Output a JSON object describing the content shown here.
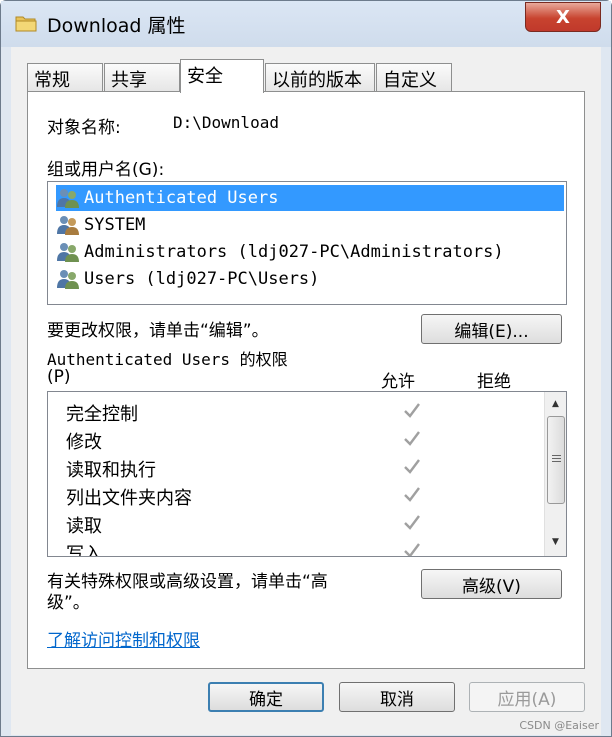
{
  "window": {
    "title": "Download 属性",
    "close_glyph": "X"
  },
  "tabs": [
    {
      "label": "常规",
      "active": false
    },
    {
      "label": "共享",
      "active": false
    },
    {
      "label": "安全",
      "active": true
    },
    {
      "label": "以前的版本",
      "active": false
    },
    {
      "label": "自定义",
      "active": false
    }
  ],
  "security": {
    "object_name_label": "对象名称:",
    "object_name_value": "D:\\Download",
    "group_label": "组或用户名(G):",
    "users": [
      {
        "name": "Authenticated Users",
        "selected": true
      },
      {
        "name": "SYSTEM",
        "selected": false
      },
      {
        "name": "Administrators (ldj027-PC\\Administrators)",
        "selected": false
      },
      {
        "name": "Users (ldj027-PC\\Users)",
        "selected": false
      }
    ],
    "change_hint": "要更改权限，请单击“编辑”。",
    "edit_button": "编辑(E)...",
    "permissions_for_line1": "Authenticated Users 的权限",
    "permissions_for_line2": "(P)",
    "allow_header": "允许",
    "deny_header": "拒绝",
    "permissions": [
      {
        "name": "完全控制",
        "allow": true,
        "deny": false
      },
      {
        "name": "修改",
        "allow": true,
        "deny": false
      },
      {
        "name": "读取和执行",
        "allow": true,
        "deny": false
      },
      {
        "name": "列出文件夹内容",
        "allow": true,
        "deny": false
      },
      {
        "name": "读取",
        "allow": true,
        "deny": false
      },
      {
        "name": "写入",
        "allow": true,
        "deny": false
      }
    ],
    "advanced_hint_line1": "有关特殊权限或高级设置，请单击“高",
    "advanced_hint_line2": "级”。",
    "advanced_button": "高级(V)",
    "learn_link": "了解访问控制和权限"
  },
  "footer": {
    "ok_button": "确定",
    "cancel_button": "取消",
    "apply_button": "应用(A)"
  },
  "watermark": "CSDN @Eaiser",
  "colors": {
    "selection": "#3399ff",
    "link": "#0066cc",
    "close_button": "#c8432f",
    "check_disabled": "#a0a0a0"
  }
}
